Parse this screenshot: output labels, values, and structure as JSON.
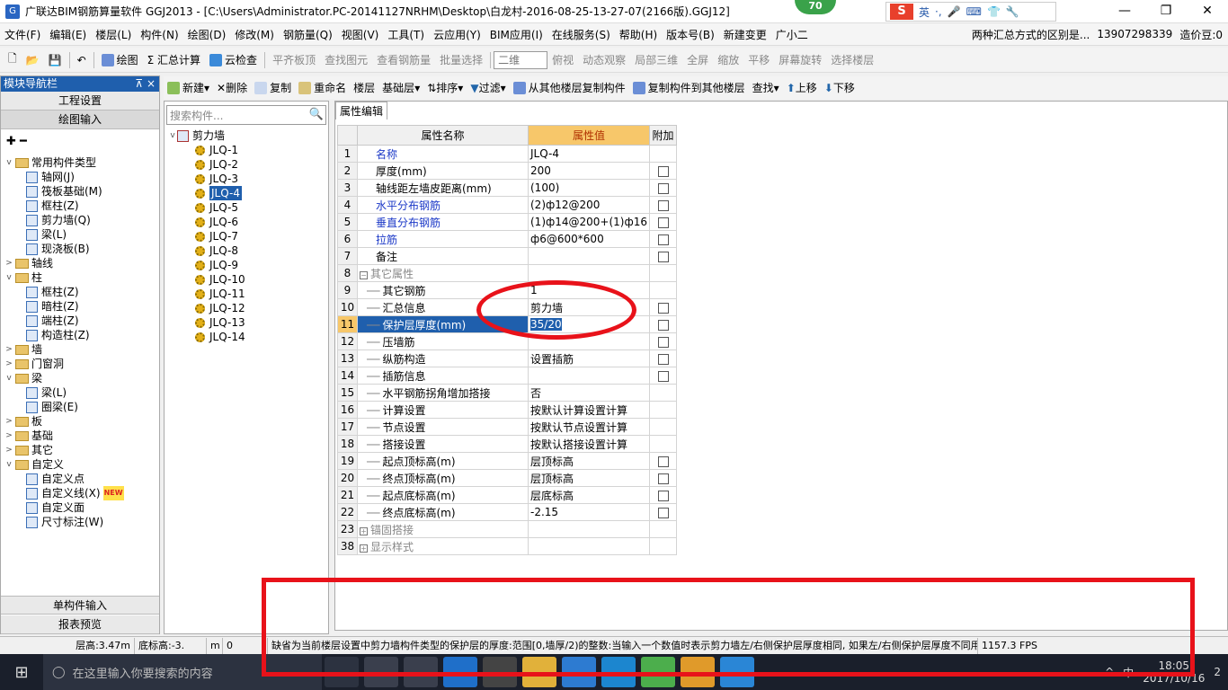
{
  "titlebar": {
    "title": "广联达BIM钢筋算量软件 GGJ2013 - [C:\\Users\\Administrator.PC-20141127NRHM\\Desktop\\白龙村-2016-08-25-13-27-07(2166版).GGJ12]",
    "badge": "70",
    "ime": [
      "英",
      "·,",
      "🎤",
      "⌨",
      "👕",
      "🔧"
    ],
    "ime_logo": "S"
  },
  "menu": {
    "items": [
      "文件(F)",
      "编辑(E)",
      "楼层(L)",
      "构件(N)",
      "绘图(D)",
      "修改(M)",
      "钢筋量(Q)",
      "视图(V)",
      "工具(T)",
      "云应用(Y)",
      "BIM应用(I)",
      "在线服务(S)",
      "帮助(H)",
      "版本号(B)",
      "新建变更",
      "广小二"
    ],
    "notice": "两种汇总方式的区别是...",
    "phone": "13907298339",
    "price": "造价豆:0"
  },
  "toolbar": {
    "items": [
      "绘图",
      "Σ 汇总计算",
      "云检查",
      "平齐板顶",
      "查找图元",
      "查看钢筋量",
      "批量选择",
      "二维",
      "俯视",
      "动态观察",
      "局部三维",
      "全屏",
      "缩放",
      "平移",
      "屏幕旋转",
      "选择楼层"
    ]
  },
  "left_panel": {
    "header": "模块导航栏",
    "pin": "⊼ ×",
    "project_settings": "工程设置",
    "drawing_input": "绘图输入",
    "single_input": "单构件输入",
    "report_preview": "报表预览",
    "tree": [
      {
        "level": 0,
        "label": "常用构件类型",
        "type": "folder",
        "exp": "v"
      },
      {
        "level": 1,
        "label": "轴网(J)",
        "type": "item"
      },
      {
        "level": 1,
        "label": "筏板基础(M)",
        "type": "item"
      },
      {
        "level": 1,
        "label": "框柱(Z)",
        "type": "item"
      },
      {
        "level": 1,
        "label": "剪力墙(Q)",
        "type": "item"
      },
      {
        "level": 1,
        "label": "梁(L)",
        "type": "item"
      },
      {
        "level": 1,
        "label": "现浇板(B)",
        "type": "item"
      },
      {
        "level": 0,
        "label": "轴线",
        "type": "folder",
        "exp": ">"
      },
      {
        "level": 0,
        "label": "柱",
        "type": "folder",
        "exp": "v"
      },
      {
        "level": 1,
        "label": "框柱(Z)",
        "type": "item"
      },
      {
        "level": 1,
        "label": "暗柱(Z)",
        "type": "item"
      },
      {
        "level": 1,
        "label": "端柱(Z)",
        "type": "item"
      },
      {
        "level": 1,
        "label": "构造柱(Z)",
        "type": "item"
      },
      {
        "level": 0,
        "label": "墙",
        "type": "folder",
        "exp": ">"
      },
      {
        "level": 0,
        "label": "门窗洞",
        "type": "folder",
        "exp": ">"
      },
      {
        "level": 0,
        "label": "梁",
        "type": "folder",
        "exp": "v"
      },
      {
        "level": 1,
        "label": "梁(L)",
        "type": "item"
      },
      {
        "level": 1,
        "label": "圈梁(E)",
        "type": "item"
      },
      {
        "level": 0,
        "label": "板",
        "type": "folder",
        "exp": ">"
      },
      {
        "level": 0,
        "label": "基础",
        "type": "folder",
        "exp": ">"
      },
      {
        "level": 0,
        "label": "其它",
        "type": "folder",
        "exp": ">"
      },
      {
        "level": 0,
        "label": "自定义",
        "type": "folder",
        "exp": "v"
      },
      {
        "level": 1,
        "label": "自定义点",
        "type": "item"
      },
      {
        "level": 1,
        "label": "自定义线(X)",
        "type": "item",
        "tag": "NEW"
      },
      {
        "level": 1,
        "label": "自定义面",
        "type": "item"
      },
      {
        "level": 1,
        "label": "尺寸标注(W)",
        "type": "item"
      }
    ]
  },
  "toolbar2": {
    "items": [
      "新建",
      "删除",
      "复制",
      "重命名",
      "楼层",
      "基础层",
      "排序",
      "过滤",
      "从其他楼层复制构件",
      "复制构件到其他楼层",
      "查找",
      "上移",
      "下移"
    ]
  },
  "component_panel": {
    "search_placeholder": "搜索构件...",
    "root": "剪力墙",
    "items": [
      "JLQ-1",
      "JLQ-2",
      "JLQ-3",
      "JLQ-4",
      "JLQ-5",
      "JLQ-6",
      "JLQ-7",
      "JLQ-8",
      "JLQ-9",
      "JLQ-10",
      "JLQ-11",
      "JLQ-12",
      "JLQ-13",
      "JLQ-14"
    ],
    "selected": "JLQ-4"
  },
  "property_panel": {
    "tab": "属性编辑",
    "headers": [
      "属性名称",
      "属性值",
      "附加"
    ],
    "rows": [
      {
        "n": "1",
        "name": "名称",
        "value": "JLQ-4",
        "cb": false,
        "style": "blue"
      },
      {
        "n": "2",
        "name": "厚度(mm)",
        "value": "200",
        "cb": true
      },
      {
        "n": "3",
        "name": "轴线距左墙皮距离(mm)",
        "value": "(100)",
        "cb": true
      },
      {
        "n": "4",
        "name": "水平分布钢筋",
        "value": "(2)ф12@200",
        "cb": true,
        "style": "blue"
      },
      {
        "n": "5",
        "name": "垂直分布钢筋",
        "value": "(1)ф14@200+(1)ф16",
        "cb": true,
        "style": "blue"
      },
      {
        "n": "6",
        "name": "拉筋",
        "value": "ф6@600*600",
        "cb": true,
        "style": "blue"
      },
      {
        "n": "7",
        "name": "备注",
        "value": "",
        "cb": true
      },
      {
        "n": "8",
        "name": "其它属性",
        "value": "",
        "cb": false,
        "style": "group",
        "box": "−"
      },
      {
        "n": "9",
        "name": "其它钢筋",
        "value": "1",
        "cb": false,
        "sub": true
      },
      {
        "n": "10",
        "name": "汇总信息",
        "value": "剪力墙",
        "cb": true,
        "sub": true
      },
      {
        "n": "11",
        "name": "保护层厚度(mm)",
        "value": "35/20",
        "cb": true,
        "sub": true,
        "selected": true
      },
      {
        "n": "12",
        "name": "压墙筋",
        "value": "",
        "cb": true,
        "sub": true
      },
      {
        "n": "13",
        "name": "纵筋构造",
        "value": "设置插筋",
        "cb": true,
        "sub": true
      },
      {
        "n": "14",
        "name": "插筋信息",
        "value": "",
        "cb": true,
        "sub": true
      },
      {
        "n": "15",
        "name": "水平钢筋拐角增加搭接",
        "value": "否",
        "cb": false,
        "sub": true
      },
      {
        "n": "16",
        "name": "计算设置",
        "value": "按默认计算设置计算",
        "cb": false,
        "sub": true
      },
      {
        "n": "17",
        "name": "节点设置",
        "value": "按默认节点设置计算",
        "cb": false,
        "sub": true
      },
      {
        "n": "18",
        "name": "搭接设置",
        "value": "按默认搭接设置计算",
        "cb": false,
        "sub": true
      },
      {
        "n": "19",
        "name": "起点顶标高(m)",
        "value": "层顶标高",
        "cb": true,
        "sub": true
      },
      {
        "n": "20",
        "name": "终点顶标高(m)",
        "value": "层顶标高",
        "cb": true,
        "sub": true
      },
      {
        "n": "21",
        "name": "起点底标高(m)",
        "value": "层底标高",
        "cb": true,
        "sub": true
      },
      {
        "n": "22",
        "name": "终点底标高(m)",
        "value": "-2.15",
        "cb": true,
        "sub": true
      },
      {
        "n": "23",
        "name": "锚固搭接",
        "value": "",
        "cb": false,
        "style": "group",
        "box": "+"
      },
      {
        "n": "38",
        "name": "显示样式",
        "value": "",
        "cb": false,
        "style": "group",
        "box": "+"
      }
    ]
  },
  "statusbar": {
    "floor_height": "层高:3.47m",
    "bottom_elev": "底标高:-3.",
    "m": "m",
    "zero": "0",
    "hint": "缺省为当前楼层设置中剪力墙构件类型的保护层的厚度:范围[0,墙厚/2)的整数:当输入一个数值时表示剪力墙左/右侧保护层厚度相同, 如果左/右侧保护层厚度不同用\"/\"隔",
    "fps": "1157.3 FPS"
  },
  "taskbar": {
    "search_placeholder": "在这里输入你要搜索的内容",
    "time": "18:05",
    "date": "2017/10/16",
    "ime_cn": "中",
    "notif": "2"
  },
  "colors": {
    "accent": "#1f5fad",
    "header_hl": "#f7c76a",
    "annotation": "#e8121a",
    "blue_text": "#1b38c7"
  }
}
